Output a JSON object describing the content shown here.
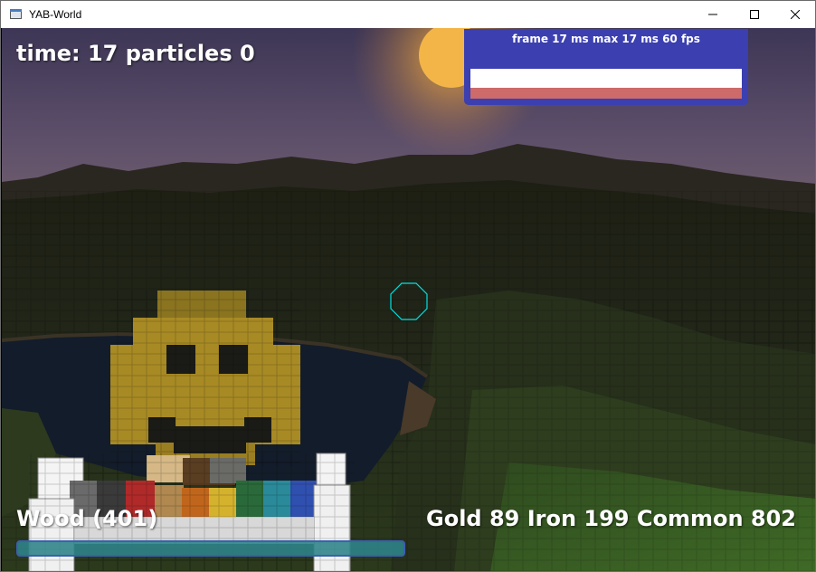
{
  "window": {
    "title": "YAB-World",
    "icon": "app-window-icon",
    "controls": [
      "minimize-icon",
      "maximize-icon",
      "close-icon"
    ]
  },
  "hud": {
    "time_label": "time: 17 particles 0",
    "selected_block_label": "Wood (401)",
    "resources_label": "Gold 89 Iron 199 Common 802",
    "progress_fraction": 1.0
  },
  "perf_overlay": {
    "label": "frame 17 ms  max 17 ms  60 fps",
    "graph_fill_fraction": 0.35
  },
  "crosshair": {
    "icon": "octagon-crosshair-icon",
    "color": "#00e0e0"
  },
  "colors": {
    "sky_top": "#3b3454",
    "sky_horizon": "#6a5a70",
    "sun": "#f0b040",
    "perf_panel": "#3b3fb0",
    "perf_bar": "#cd6a6a",
    "progress_border": "#3b5fb0",
    "progress_fill": "#2f8c8c"
  }
}
